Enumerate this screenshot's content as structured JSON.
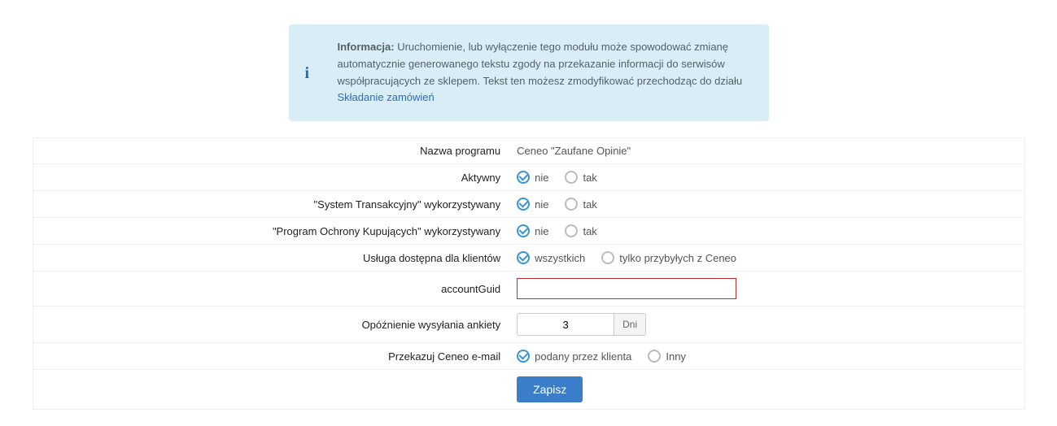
{
  "info": {
    "label": "Informacja:",
    "text_a": " Uruchomienie, lub wyłączenie tego modułu może spowodować zmianę automatycznie generowanego tekstu zgody na przekazanie informacji do serwisów współpracujących ze sklepem. Tekst ten możesz zmodyfikować przechodząc do działu ",
    "link_text": "Składanie zamówień"
  },
  "rows": {
    "program_name": {
      "label": "Nazwa programu",
      "value": "Ceneo \"Zaufane Opinie\""
    },
    "active": {
      "label": "Aktywny",
      "opt1": "nie",
      "opt2": "tak"
    },
    "trans_system": {
      "label": "\"System Transakcyjny\" wykorzystywany",
      "opt1": "nie",
      "opt2": "tak"
    },
    "buyer_prot": {
      "label": "\"Program Ochrony Kupujących\" wykorzystywany",
      "opt1": "nie",
      "opt2": "tak"
    },
    "service_avail": {
      "label": "Usługa dostępna dla klientów",
      "opt1": "wszystkich",
      "opt2": "tylko przybyłych z Ceneo"
    },
    "account_guid": {
      "label": "accountGuid",
      "value": ""
    },
    "delay": {
      "label": "Opóźnienie wysyłania ankiety",
      "value": "3",
      "unit": "Dni"
    },
    "forward_email": {
      "label": "Przekazuj Ceneo e-mail",
      "opt1": "podany przez klienta",
      "opt2": "Inny"
    }
  },
  "button": {
    "save": "Zapisz"
  }
}
